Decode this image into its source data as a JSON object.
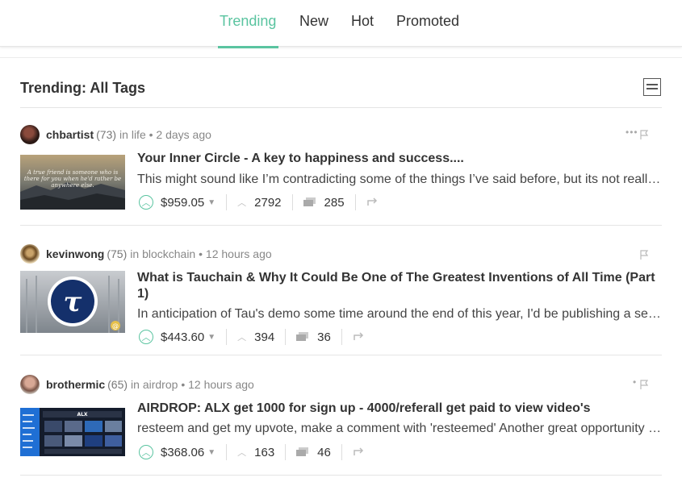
{
  "nav": {
    "tabs": [
      {
        "label": "Trending",
        "active": true
      },
      {
        "label": "New",
        "active": false
      },
      {
        "label": "Hot",
        "active": false
      },
      {
        "label": "Promoted",
        "active": false
      }
    ]
  },
  "section": {
    "title": "Trending: All Tags"
  },
  "colors": {
    "accent": "#5ac4a0",
    "text": "#333333",
    "muted": "#888888"
  },
  "posts": [
    {
      "author": "chbartist",
      "reputation": "(73)",
      "in_text": "in",
      "category": "life",
      "time": "2 days ago",
      "title": "Your Inner Circle - A key to happiness and success....",
      "body": "This might sound like I’m contradicting some of the things I’ve said before, but its not really...",
      "payout": "$959.05",
      "votes": "2792",
      "comments": "285",
      "thumb_text": "A true friend is someone who is there for you when he'd rather be anywhere else."
    },
    {
      "author": "kevinwong",
      "reputation": "(75)",
      "in_text": "in",
      "category": "blockchain",
      "time": "12 hours ago",
      "title": "What is Tauchain & Why It Could Be One of The Greatest Inventions of All Time (Part 1)",
      "body": "In anticipation of Tau's demo some time around the end of this year, I'd be publishing a series",
      "payout": "$443.60",
      "votes": "394",
      "comments": "36",
      "thumb_text": "τ"
    },
    {
      "author": "brothermic",
      "reputation": "(65)",
      "in_text": "in",
      "category": "airdrop",
      "time": "12 hours ago",
      "title": "AIRDROP: ALX get 1000 for sign up - 4000/referall get paid to view video's",
      "body": "resteem and get my upvote, make a comment with 'resteemed' Another great opportunity awaits",
      "payout": "$368.06",
      "votes": "163",
      "comments": "46",
      "thumb_text": "ALX"
    }
  ]
}
